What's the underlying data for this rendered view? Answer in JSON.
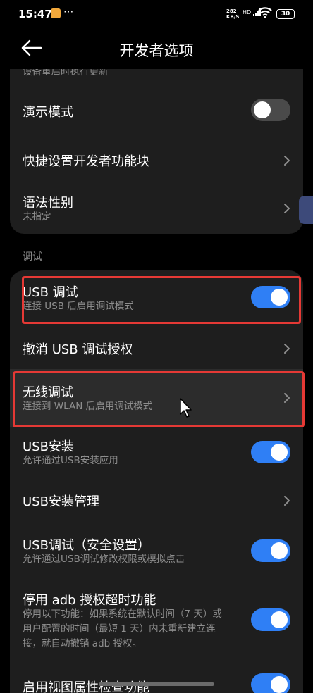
{
  "status_bar": {
    "time": "15:47",
    "dots": "···",
    "speed_value": "282",
    "speed_unit": "KB/S",
    "signal": "HD",
    "battery": "30"
  },
  "header": {
    "title": "开发者选项"
  },
  "settings_top": [
    {
      "title": "",
      "subtitle": "设备重启时执行更新",
      "control": "toggle",
      "state": "off"
    },
    {
      "title": "演示模式",
      "control": "toggle",
      "state": "off"
    },
    {
      "title": "快捷设置开发者功能块",
      "control": "chevron"
    },
    {
      "title": "语法性别",
      "subtitle": "未指定",
      "control": "chevron"
    }
  ],
  "section_debug": {
    "label": "调试"
  },
  "settings_debug": [
    {
      "title": "USB 调试",
      "subtitle": "连接 USB 后启用调试模式",
      "control": "toggle",
      "state": "on"
    },
    {
      "title": "撤消 USB 调试授权",
      "control": "chevron"
    },
    {
      "title": "无线调试",
      "subtitle": "连接到 WLAN 后启用调试模式",
      "control": "chevron"
    },
    {
      "title": "USB安装",
      "subtitle": "允许通过USB安装应用",
      "control": "toggle",
      "state": "on"
    },
    {
      "title": "USB安装管理",
      "control": "chevron"
    },
    {
      "title": "USB调试（安全设置）",
      "subtitle": "允许通过USB调试修改权限或模拟点击",
      "control": "toggle",
      "state": "on"
    },
    {
      "title": "停用 adb 授权超时功能",
      "subtitle_lines": [
        "停用以下功能：如果系统在默认时间（7 天）或",
        "用户配置的时间（最短 1 天）内未重新建立连",
        "接，就自动撤销 adb 授权。"
      ],
      "control": "toggle",
      "state": "on"
    },
    {
      "title": "启用视图属性检查功能",
      "control": "toggle",
      "state": "on"
    }
  ],
  "colors": {
    "background": "#000000",
    "card": "#1e1e1e",
    "toggle_on": "#2f7ff5",
    "toggle_off": "#4a4a4a",
    "highlight": "#e53935",
    "secondary_text": "#8e8e8e"
  },
  "icons": [
    "back-arrow-icon",
    "chevron-right-icon",
    "wifi-icon",
    "battery-icon",
    "mouse-cursor-icon"
  ]
}
